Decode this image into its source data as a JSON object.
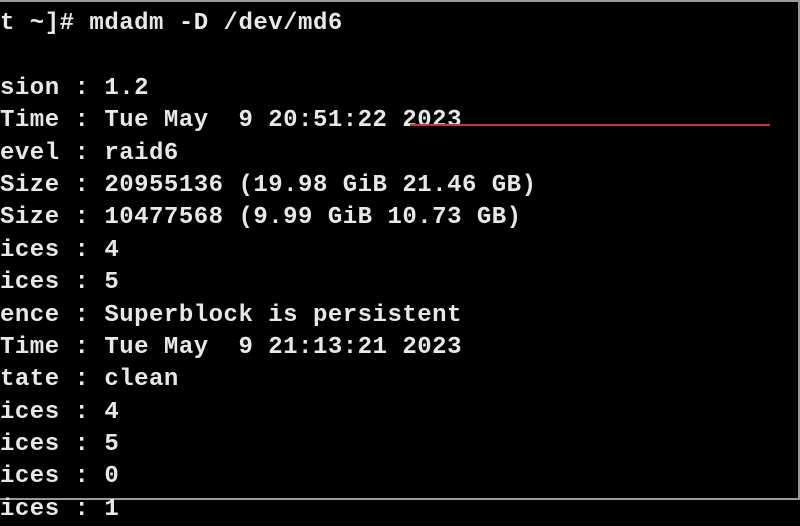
{
  "terminal": {
    "prompt": "t ~]# mdadm -D /dev/md6",
    "lines": [
      "sion : 1.2",
      "Time : Tue May  9 20:51:22 2023",
      "evel : raid6",
      "Size : 20955136 (19.98 GiB 21.46 GB)",
      "Size : 10477568 (9.99 GiB 10.73 GB)",
      "ices : 4",
      "ices : 5",
      "ence : Superblock is persistent",
      "",
      "Time : Tue May  9 21:13:21 2023",
      "tate : clean",
      "ices : 4",
      "ices : 5",
      "ices : 0",
      "ices : 1"
    ]
  }
}
